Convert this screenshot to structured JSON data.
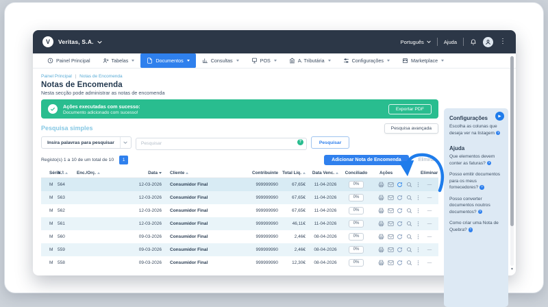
{
  "colors": {
    "accent_blue": "#2f80ed",
    "navy_header": "#2c3747",
    "success_green": "#29bd8f",
    "sidebar_bg": "#dde9f4",
    "row_alt": "#e9f4f9",
    "row_selected": "#d8ebf4",
    "link_blue": "#58abd6",
    "annotation_arrow": "#1e7ceb"
  },
  "topbar": {
    "brand": "Veritas, S.A.",
    "language": "Português",
    "help": "Ajuda"
  },
  "menu": {
    "items": [
      {
        "label": "Painel Principal",
        "icon": "dashboard-clock-icon",
        "active": false,
        "caret": false
      },
      {
        "label": "Tabelas",
        "icon": "tables-icon",
        "active": false,
        "caret": true
      },
      {
        "label": "Documentos",
        "icon": "document-icon",
        "active": true,
        "caret": true
      },
      {
        "label": "Consultas",
        "icon": "bar-chart-icon",
        "active": false,
        "caret": true
      },
      {
        "label": "POS",
        "icon": "pos-terminal-icon",
        "active": false,
        "caret": true
      },
      {
        "label": "A. Tributária",
        "icon": "bank-icon",
        "active": false,
        "caret": true
      },
      {
        "label": "Configurações",
        "icon": "sliders-icon",
        "active": false,
        "caret": true
      },
      {
        "label": "Marketplace",
        "icon": "storefront-icon",
        "active": false,
        "caret": true
      }
    ]
  },
  "breadcrumb": {
    "home": "Painel Principal",
    "sep": "|",
    "current": "Notas de Encomenda"
  },
  "page": {
    "title": "Notas de Encomenda",
    "subtitle": "Nesta secção pode administrar as notas de encomenda"
  },
  "banner": {
    "title": "Ações executadas com sucesso:",
    "message": "Documento adicionado com sucesso!",
    "export_button": "Exportar PDF"
  },
  "search": {
    "section_title": "Pesquisa simples",
    "advanced_button": "Pesquisa avançada",
    "input_label": "Insira palavras para pesquisar",
    "placeholder": "Pesquisar",
    "help_badge": "?",
    "submit_button": "Pesquisar"
  },
  "records": {
    "summary": "Registo(s) 1 a 10 de um total de 10",
    "page_number": "1",
    "add_button": "Adicionar Nota de Encomenda",
    "delete_action": "Eliminar"
  },
  "table": {
    "headers": [
      {
        "label": "Série",
        "sort": "up"
      },
      {
        "label": "N.º",
        "sort": "up"
      },
      {
        "label": "Enc./Orç.",
        "sort": "up"
      },
      {
        "label": "Data",
        "sort": "down"
      },
      {
        "label": "Cliente",
        "sort": "up"
      },
      {
        "label": "Contribuinte",
        "sort": "none"
      },
      {
        "label": "Total Líq.",
        "sort": "up"
      },
      {
        "label": "Data Venc.",
        "sort": "up"
      },
      {
        "label": "Conciliado",
        "sort": "none"
      },
      {
        "label": "Ações",
        "sort": "none"
      },
      {
        "label": "Eliminar",
        "sort": "none"
      }
    ],
    "action_icons": [
      "print-icon",
      "email-icon",
      "convert-refresh-icon",
      "preview-search-icon",
      "more-kebab-icon"
    ],
    "rows": [
      {
        "serie": "M",
        "numero": "564",
        "enc_orc": "",
        "data": "12-03-2026",
        "cliente": "Consumidor Final",
        "contribuinte": "999999990",
        "total_liq": "67,65€",
        "data_venc": "11-04-2026",
        "conciliado": "0%",
        "eliminar": "—",
        "selected": true,
        "highlight_refresh": true
      },
      {
        "serie": "M",
        "numero": "563",
        "enc_orc": "",
        "data": "12-03-2026",
        "cliente": "Consumidor Final",
        "contribuinte": "999999990",
        "total_liq": "67,65€",
        "data_venc": "11-04-2026",
        "conciliado": "0%",
        "eliminar": "—",
        "selected": false,
        "highlight_refresh": false
      },
      {
        "serie": "M",
        "numero": "562",
        "enc_orc": "",
        "data": "12-03-2026",
        "cliente": "Consumidor Final",
        "contribuinte": "999999990",
        "total_liq": "67,65€",
        "data_venc": "11-04-2026",
        "conciliado": "0%",
        "eliminar": "—",
        "selected": false,
        "highlight_refresh": false
      },
      {
        "serie": "M",
        "numero": "561",
        "enc_orc": "",
        "data": "12-03-2026",
        "cliente": "Consumidor Final",
        "contribuinte": "999999990",
        "total_liq": "46,11€",
        "data_venc": "11-04-2026",
        "conciliado": "0%",
        "eliminar": "—",
        "selected": false,
        "highlight_refresh": false
      },
      {
        "serie": "M",
        "numero": "560",
        "enc_orc": "",
        "data": "09-03-2026",
        "cliente": "Consumidor Final",
        "contribuinte": "999999990",
        "total_liq": "2,46€",
        "data_venc": "08-04-2026",
        "conciliado": "0%",
        "eliminar": "—",
        "selected": false,
        "highlight_refresh": false
      },
      {
        "serie": "M",
        "numero": "559",
        "enc_orc": "",
        "data": "09-03-2026",
        "cliente": "Consumidor Final",
        "contribuinte": "999999990",
        "total_liq": "2,46€",
        "data_venc": "08-04-2026",
        "conciliado": "0%",
        "eliminar": "—",
        "selected": false,
        "highlight_refresh": false
      },
      {
        "serie": "M",
        "numero": "558",
        "enc_orc": "",
        "data": "09-03-2026",
        "cliente": "Consumidor Final",
        "contribuinte": "999999990",
        "total_liq": "12,30€",
        "data_venc": "08-04-2026",
        "conciliado": "0%",
        "eliminar": "—",
        "selected": false,
        "highlight_refresh": false
      }
    ]
  },
  "sidebar": {
    "badge_glyph": "?",
    "play_glyph": "▶",
    "config_title": "Configurações",
    "config_item": "Escolha as colunas que deseja ver na listagem",
    "help_title": "Ajuda",
    "help_items": [
      "Que elementos devem conter as faturas?",
      "Posso emitir documentos para os meus fornecedores?",
      "Posso converter documentos noutros documentos?",
      "Como criar uma Nota de Quebra?"
    ]
  }
}
